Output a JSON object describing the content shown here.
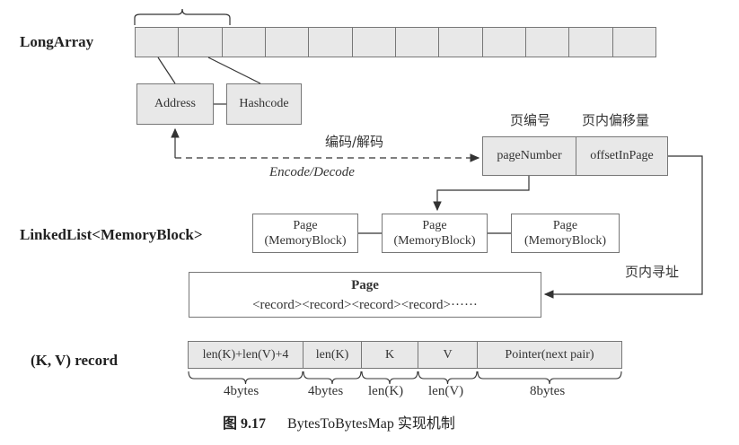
{
  "labels": {
    "long_array": "LongArray",
    "linked_list": "LinkedList<MemoryBlock>",
    "kv_record": "(K, V) record"
  },
  "long_array": {
    "cell_count": 12
  },
  "address_box": "Address",
  "hashcode_box": "Hashcode",
  "encode_cn": "编码/解码",
  "encode_en": "Encode/Decode",
  "page_number_cn": "页编号",
  "offset_cn": "页内偏移量",
  "page_number_box": "pageNumber",
  "offset_box": "offsetInPage",
  "pages": [
    {
      "line1": "Page",
      "line2": "(MemoryBlock)"
    },
    {
      "line1": "Page",
      "line2": "(MemoryBlock)"
    },
    {
      "line1": "Page",
      "line2": "(MemoryBlock)"
    }
  ],
  "page_addressing_cn": "页内寻址",
  "page_box": {
    "title": "Page",
    "records": "<record><record><record><record>······"
  },
  "record_fields": [
    {
      "label": "len(K)+len(V)+4",
      "size": "4bytes"
    },
    {
      "label": "len(K)",
      "size": "4bytes"
    },
    {
      "label": "K",
      "size": "len(K)"
    },
    {
      "label": "V",
      "size": "len(V)"
    },
    {
      "label": "Pointer(next pair)",
      "size": "8bytes"
    }
  ],
  "caption": {
    "number": "图 9.17",
    "text": "BytesToBytesMap 实现机制"
  }
}
